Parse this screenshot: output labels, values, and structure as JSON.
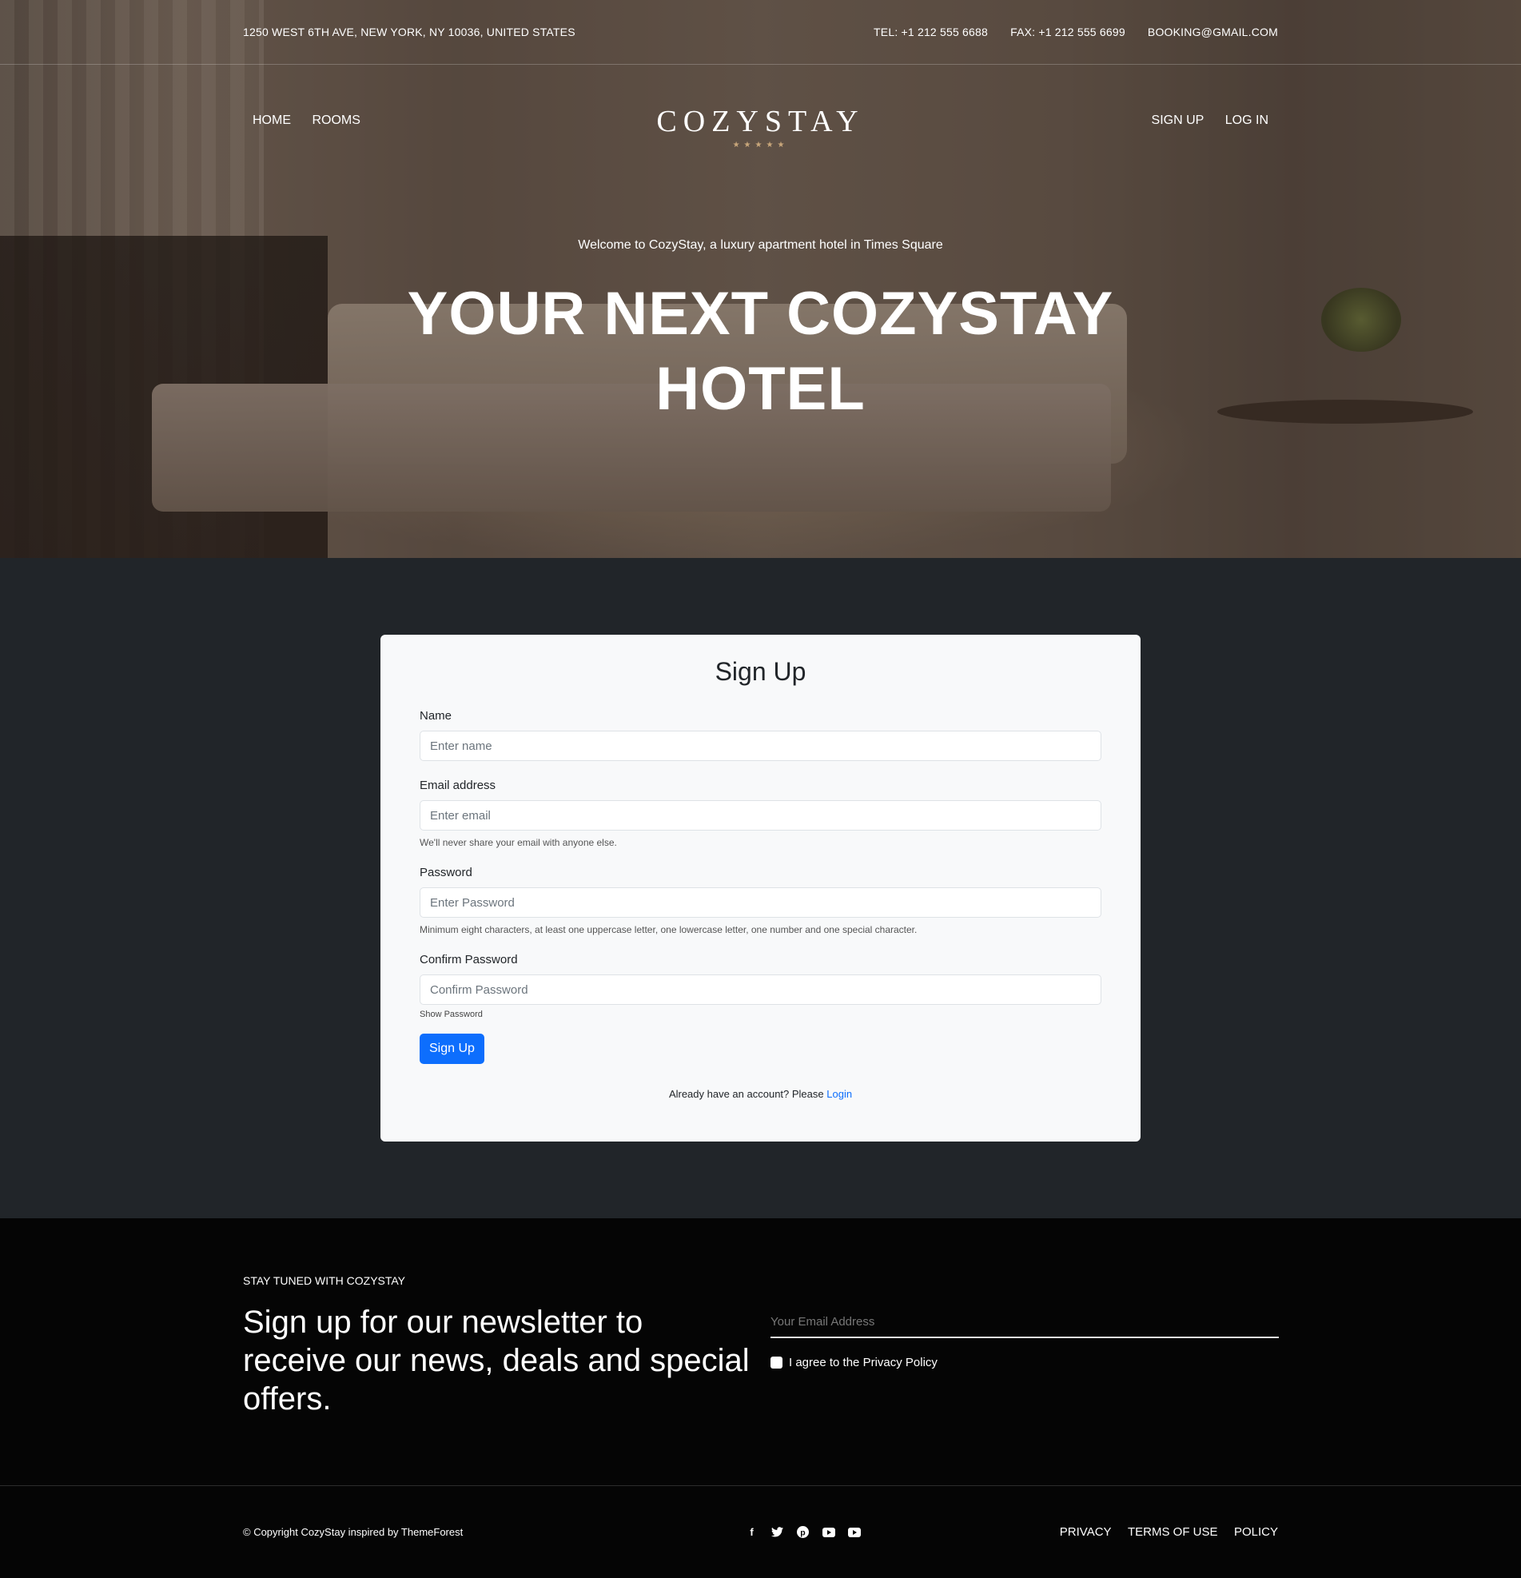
{
  "topbar": {
    "address": "1250 WEST 6TH AVE, NEW YORK, NY 10036, UNITED STATES",
    "tel": "TEL: +1 212 555 6688",
    "fax": "FAX: +1 212 555 6699",
    "email": "BOOKING@GMAIL.COM"
  },
  "nav": {
    "left": [
      "HOME",
      "ROOMS"
    ],
    "right": [
      "SIGN UP",
      "LOG IN"
    ]
  },
  "logo": {
    "name": "COZYSTAY",
    "stars": "★★★★★"
  },
  "hero": {
    "subtitle": "Welcome to CozyStay, a luxury apartment hotel in Times Square",
    "title_line1": "YOUR NEXT COZYSTAY",
    "title_line2": "HOTEL"
  },
  "signup": {
    "title": "Sign Up",
    "name_label": "Name",
    "name_placeholder": "Enter name",
    "email_label": "Email address",
    "email_placeholder": "Enter email",
    "email_hint": "We'll never share your email with anyone else.",
    "password_label": "Password",
    "password_placeholder": "Enter Password",
    "password_hint": "Minimum eight characters, at least one uppercase letter, one lowercase letter, one number and one special character.",
    "confirm_label": "Confirm Password",
    "confirm_placeholder": "Confirm Password",
    "show_password": "Show Password",
    "button": "Sign Up",
    "login_prompt": "Already have an account? Please ",
    "login_link": "Login"
  },
  "newsletter": {
    "kicker": "STAY TUNED WITH COZYSTAY",
    "title": "Sign up for our newsletter to receive our news, deals and special offers.",
    "email_placeholder": "Your Email Address",
    "agree": "I agree to the Privacy Policy"
  },
  "footer": {
    "copyright": "© Copyright CozyStay inspired by ThemeForest",
    "social_icons": [
      "facebook-icon",
      "twitter-icon",
      "pinterest-icon",
      "youtube-icon",
      "youtube-icon"
    ],
    "links": [
      "PRIVACY",
      "TERMS OF USE",
      "POLICY"
    ]
  },
  "colors": {
    "page_bg": "#212529",
    "card_bg": "#f8f9fa",
    "primary": "#0d6efd",
    "footer_bg": "#050505",
    "star": "#c9a77b"
  }
}
